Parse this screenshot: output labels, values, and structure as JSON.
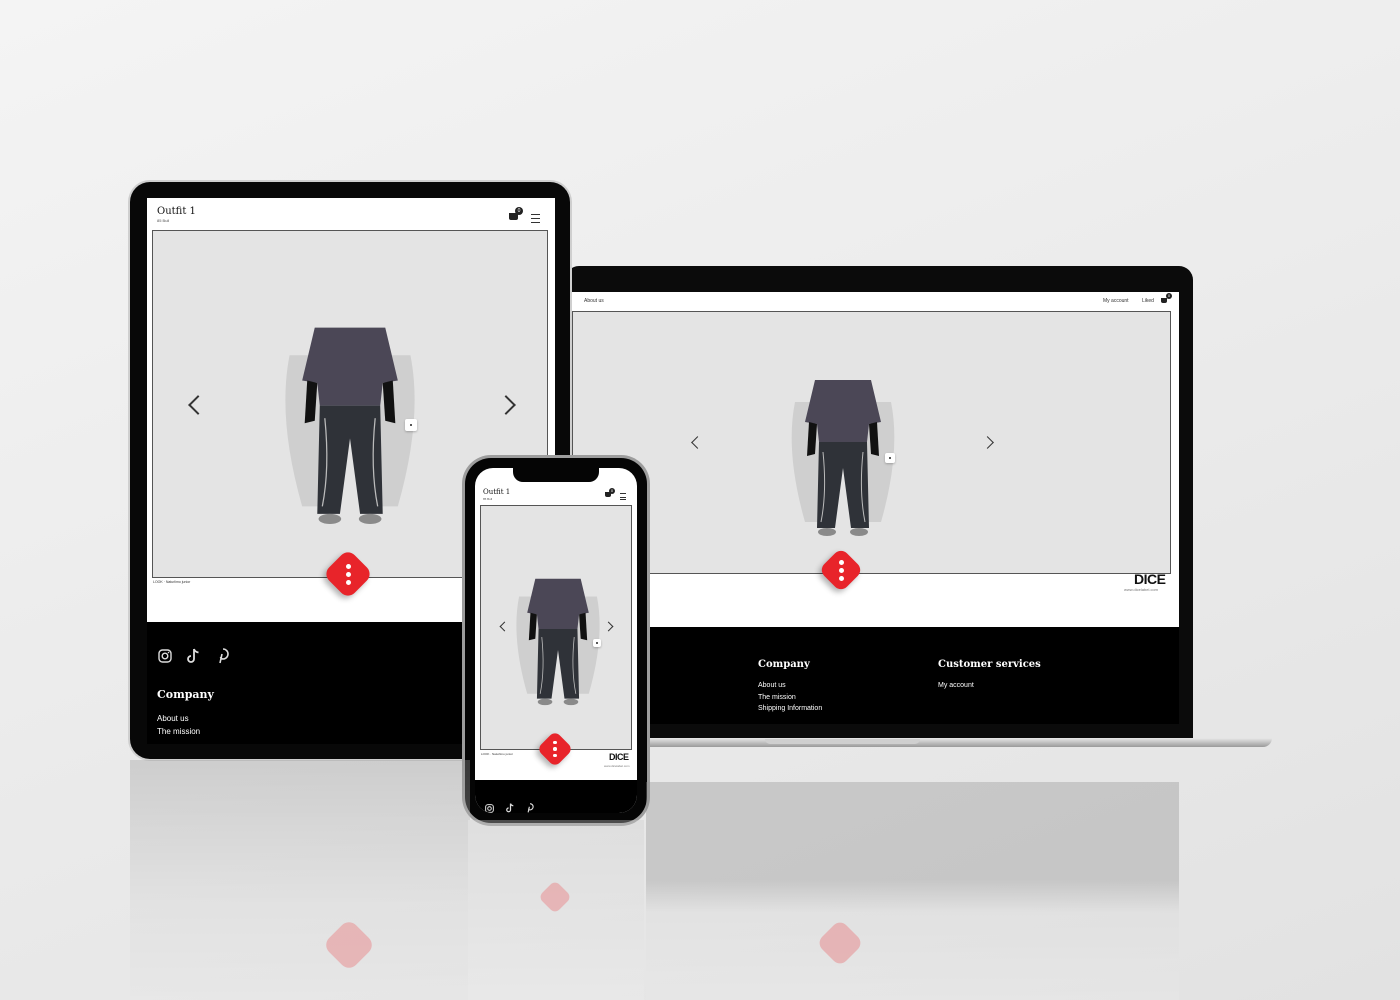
{
  "brand": {
    "logo": "DICE",
    "website": "www.dicelabel.com"
  },
  "tablet": {
    "title": "Outfit 1",
    "subtitle": "85 Bull",
    "cart_count": "0",
    "credit": "LOOK · Naturlimo junior",
    "footer_heading": "Company",
    "footer_links": [
      "About us",
      "The mission"
    ]
  },
  "laptop": {
    "nav_left": "About us",
    "nav_right": [
      "My account",
      "Liked"
    ],
    "cart_count": "0",
    "company_heading": "Company",
    "company_links": [
      "About us",
      "The mission",
      "Shipping Information"
    ],
    "services_heading": "Customer services",
    "services_links": [
      "My account"
    ]
  },
  "phone": {
    "title": "Outfit 1",
    "subtitle": "85 Bull",
    "cart_count": "0",
    "credit": "LOOK · Naturlimo junior"
  },
  "icons": [
    "instagram-icon",
    "tiktok-icon",
    "pinterest-icon",
    "cart-icon",
    "menu-icon",
    "chevron-left-icon",
    "chevron-right-icon",
    "dice-icon"
  ],
  "colors": {
    "accent": "#e8242a",
    "frame": "#0a0a0a",
    "stage": "#e4e4e4",
    "footer": "#000000"
  }
}
